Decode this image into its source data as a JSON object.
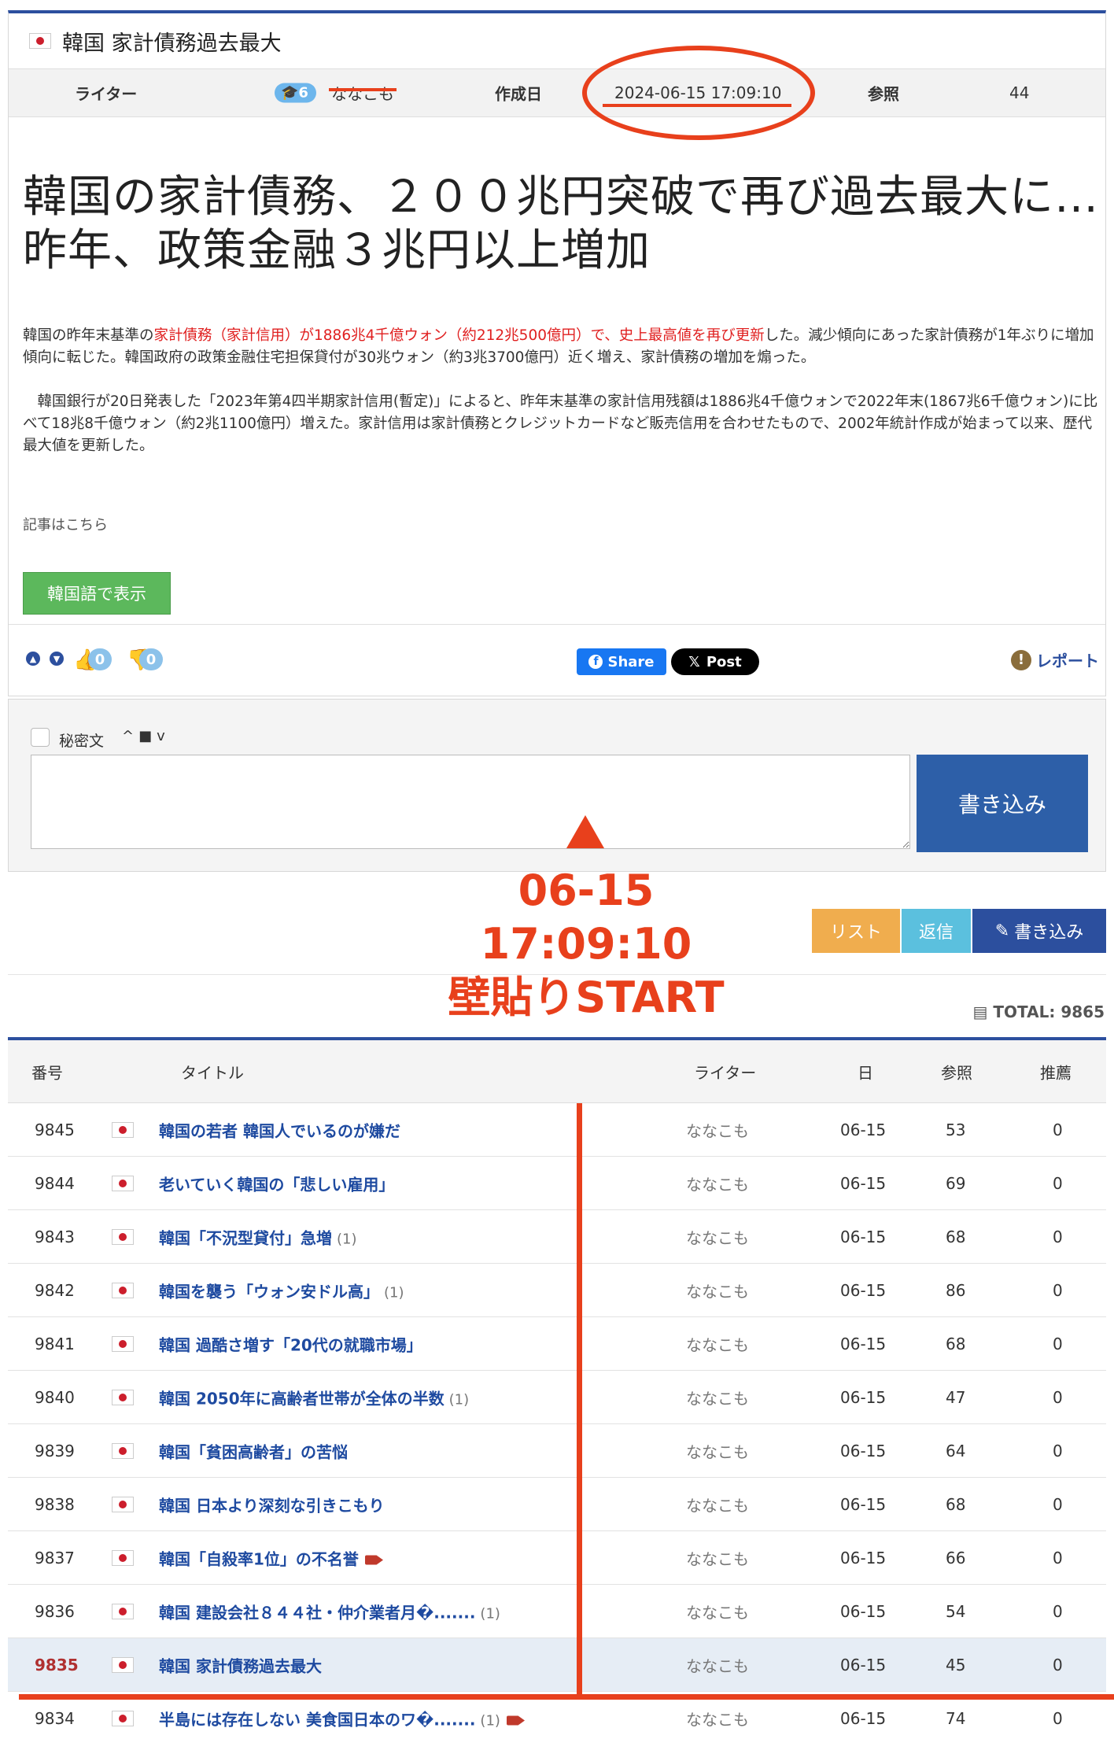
{
  "post": {
    "header_title": "韓国 家計債務過去最大",
    "meta": {
      "writer_label": "ライター",
      "badge": "🎓6",
      "author": "ななこも",
      "date_label": "作成日",
      "date": "2024-06-15 17:09:10",
      "views_label": "参照",
      "views": "44"
    },
    "title": "韓国の家計債務、２００兆円突破で再び過去最大に…昨年、政策金融３兆円以上増加",
    "p1_a": "韓国の昨年末基準の",
    "p1_red": "家計債務（家計信用）が1886兆4千億ウォン（約212兆500億円）で、史上最高値を再び更新",
    "p1_b": "した。減少傾向にあった家計債務が1年ぶりに増加傾向に転じた。韓国政府の政策金融住宅担保貸付が30兆ウォン（約3兆3700億円）近く増え、家計債務の増加を煽った。",
    "p2": "　韓国銀行が20日発表した「2023年第4四半期家計信用(暫定)」によると、昨年末基準の家計信用残額は1886兆4千億ウォンで2022年末(1867兆6千億ウォン)に比べて18兆8千億ウォン（約2兆1100億円）増えた。家計信用は家計債務とクレジットカードなど販売信用を合わせたもので、2002年統計作成が始まって以来、歴代最大値を更新した。",
    "source_link": "記事はこちら",
    "korean_button": "韓国語で表示",
    "likes": "0",
    "dislikes": "0",
    "share_label": "Share",
    "post_label": "Post",
    "report_label": "レポート"
  },
  "comment": {
    "secret_label": "秘密文",
    "tools": "^■v",
    "write_button": "書き込み"
  },
  "actions": {
    "list": "リスト",
    "reply": "返信",
    "write": "書き込み",
    "total": "TOTAL: 9865"
  },
  "annotation": {
    "line1": "06-15",
    "line2": "17:09:10",
    "line3": "壁貼りSTART"
  },
  "table": {
    "headers": {
      "no": "番号",
      "title": "タイトル",
      "writer": "ライター",
      "date": "日",
      "views": "参照",
      "rec": "推薦"
    },
    "rows": [
      {
        "no": "9845",
        "title": "韓国の若者 韓国人でいるのが嫌だ",
        "comments": "",
        "video": false,
        "writer": "ななこも",
        "date": "06-15",
        "views": "53",
        "rec": "0"
      },
      {
        "no": "9844",
        "title": "老いていく韓国の「悲しい雇用」",
        "comments": "",
        "video": false,
        "writer": "ななこも",
        "date": "06-15",
        "views": "69",
        "rec": "0"
      },
      {
        "no": "9843",
        "title": "韓国「不況型貸付」急増",
        "comments": "(1)",
        "video": false,
        "writer": "ななこも",
        "date": "06-15",
        "views": "68",
        "rec": "0"
      },
      {
        "no": "9842",
        "title": "韓国を襲う「ウォン安ドル高」",
        "comments": "(1)",
        "video": false,
        "writer": "ななこも",
        "date": "06-15",
        "views": "86",
        "rec": "0"
      },
      {
        "no": "9841",
        "title": "韓国 過酷さ増す「20代の就職市場」",
        "comments": "",
        "video": false,
        "writer": "ななこも",
        "date": "06-15",
        "views": "68",
        "rec": "0"
      },
      {
        "no": "9840",
        "title": "韓国 2050年に高齢者世帯が全体の半数",
        "comments": "(1)",
        "video": false,
        "writer": "ななこも",
        "date": "06-15",
        "views": "47",
        "rec": "0"
      },
      {
        "no": "9839",
        "title": "韓国「貧困高齢者」の苦悩",
        "comments": "",
        "video": false,
        "writer": "ななこも",
        "date": "06-15",
        "views": "64",
        "rec": "0"
      },
      {
        "no": "9838",
        "title": "韓国 日本より深刻な引きこもり",
        "comments": "",
        "video": false,
        "writer": "ななこも",
        "date": "06-15",
        "views": "68",
        "rec": "0"
      },
      {
        "no": "9837",
        "title": "韓国「自殺率1位」の不名誉",
        "comments": "",
        "video": true,
        "writer": "ななこも",
        "date": "06-15",
        "views": "66",
        "rec": "0"
      },
      {
        "no": "9836",
        "title": "韓国 建設会社８４４社・仲介業者月�.......",
        "comments": "(1)",
        "video": false,
        "writer": "ななこも",
        "date": "06-15",
        "views": "54",
        "rec": "0"
      },
      {
        "no": "9835",
        "title": "韓国 家計債務過去最大",
        "comments": "",
        "video": false,
        "writer": "ななこも",
        "date": "06-15",
        "views": "45",
        "rec": "0",
        "selected": true
      },
      {
        "no": "9834",
        "title": "半島には存在しない 美食国日本のワ�.......",
        "comments": "(1)",
        "video": true,
        "writer": "ななこも",
        "date": "06-15",
        "views": "74",
        "rec": "0"
      }
    ]
  },
  "colors": {
    "accent": "#2c4f9e",
    "annotation": "#e8401c",
    "link": "#1e4aa0"
  }
}
